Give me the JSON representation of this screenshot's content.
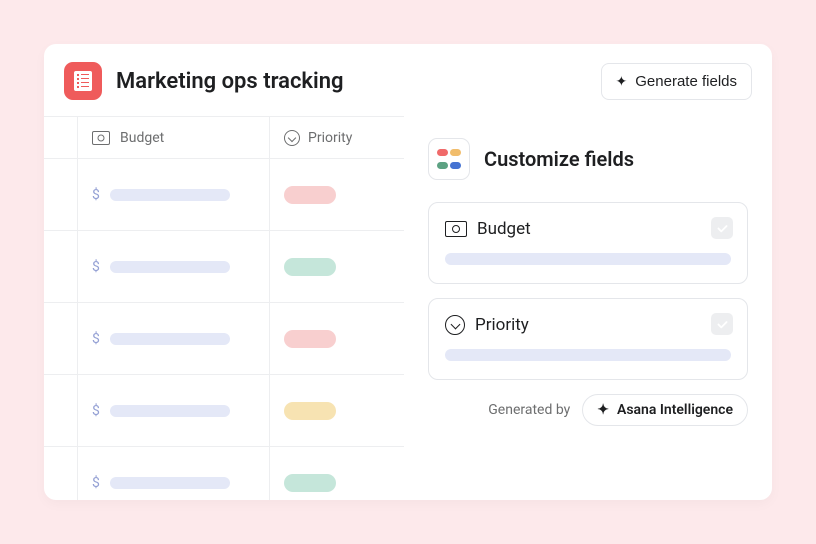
{
  "header": {
    "title": "Marketing ops tracking",
    "generate_button": "Generate fields"
  },
  "table": {
    "columns": {
      "budget": "Budget",
      "priority": "Priority"
    },
    "rows": [
      {
        "currency": "$",
        "priority_color": "red"
      },
      {
        "currency": "$",
        "priority_color": "green"
      },
      {
        "currency": "$",
        "priority_color": "red"
      },
      {
        "currency": "$",
        "priority_color": "yellow"
      },
      {
        "currency": "$",
        "priority_color": "green"
      }
    ]
  },
  "panel": {
    "title": "Customize fields",
    "fields": [
      {
        "icon": "money",
        "label": "Budget",
        "checked": true
      },
      {
        "icon": "chevcircle",
        "label": "Priority",
        "checked": true
      }
    ],
    "generated_by_label": "Generated by",
    "ai_chip": "Asana Intelligence"
  }
}
